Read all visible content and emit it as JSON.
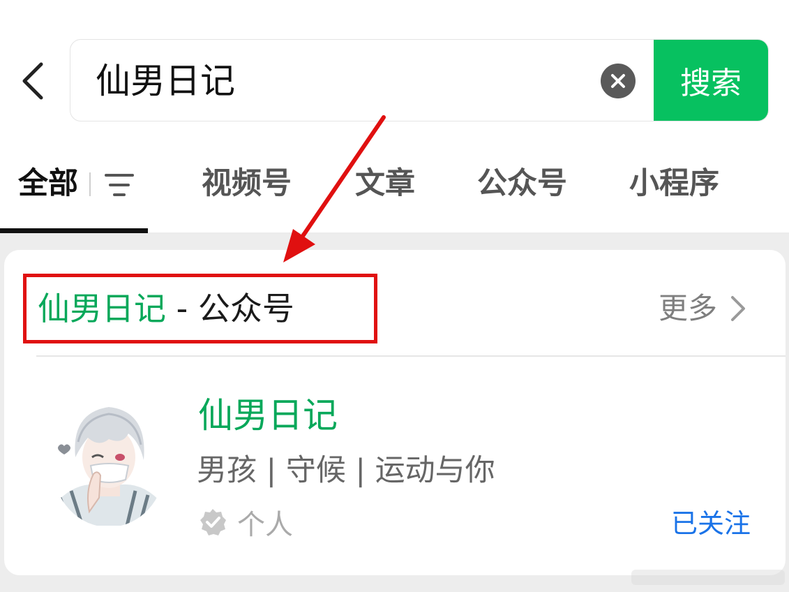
{
  "search": {
    "query": "仙男日记",
    "button_label": "搜索"
  },
  "tabs": [
    {
      "label": "全部",
      "active": true
    },
    {
      "label": "视频号",
      "active": false
    },
    {
      "label": "文章",
      "active": false
    },
    {
      "label": "公众号",
      "active": false
    },
    {
      "label": "小程序",
      "active": false
    }
  ],
  "result_section": {
    "title_highlight": "仙男日记",
    "title_suffix": " - 公众号",
    "more_label": "更多"
  },
  "account": {
    "name": "仙男日记",
    "description": "男孩 | 守候 | 运动与你",
    "type_label": "个人",
    "follow_status": "已关注"
  },
  "colors": {
    "accent_green": "#07c160",
    "highlight_green": "#07a85a",
    "annotation_red": "#e01010",
    "link_blue": "#1a73e8"
  },
  "icons": {
    "back": "chevron-left-icon",
    "clear": "close-circle-icon",
    "filter": "filter-lines-icon",
    "more": "chevron-right-icon",
    "verified": "verified-badge-icon"
  }
}
